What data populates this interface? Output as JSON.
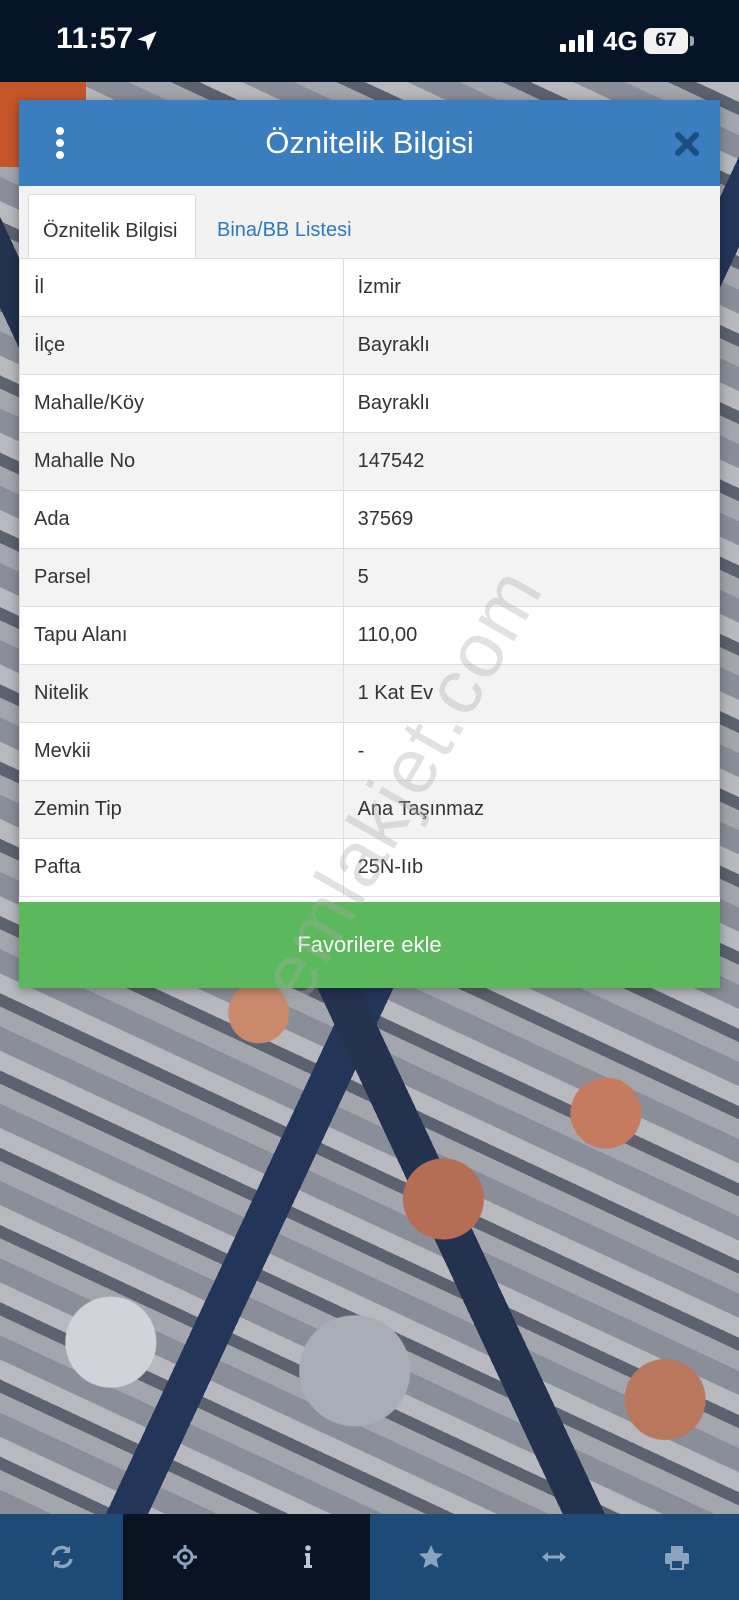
{
  "status_bar": {
    "time": "11:57",
    "network": "4G",
    "battery": "67"
  },
  "dialog": {
    "title": "Öznitelik Bilgisi",
    "tabs": [
      {
        "label": "Öznitelik Bilgisi",
        "active": true
      },
      {
        "label": "Bina/BB Listesi",
        "active": false
      }
    ],
    "rows": [
      {
        "key": "İl",
        "value": "İzmir"
      },
      {
        "key": "İlçe",
        "value": "Bayraklı"
      },
      {
        "key": "Mahalle/Köy",
        "value": "Bayraklı"
      },
      {
        "key": "Mahalle No",
        "value": "147542"
      },
      {
        "key": "Ada",
        "value": "37569"
      },
      {
        "key": "Parsel",
        "value": "5"
      },
      {
        "key": "Tapu Alanı",
        "value": "110,00"
      },
      {
        "key": "Nitelik",
        "value": "1 Kat Ev"
      },
      {
        "key": "Mevkii",
        "value": "-"
      },
      {
        "key": "Zemin Tip",
        "value": "Ana Taşınmaz"
      },
      {
        "key": "Pafta",
        "value": "25N-Iıb"
      }
    ],
    "favorite_button": "Favorilere ekle"
  },
  "watermark": "emlakjet.com",
  "toolbar": {
    "items": [
      "refresh-icon",
      "locate-icon",
      "info-icon",
      "star-icon",
      "measure-icon",
      "print-icon"
    ]
  },
  "colors": {
    "header": "#3a7ebf",
    "favorite": "#5cb85c",
    "toolbar": "#1e4a78",
    "status_bar": "#061427"
  }
}
